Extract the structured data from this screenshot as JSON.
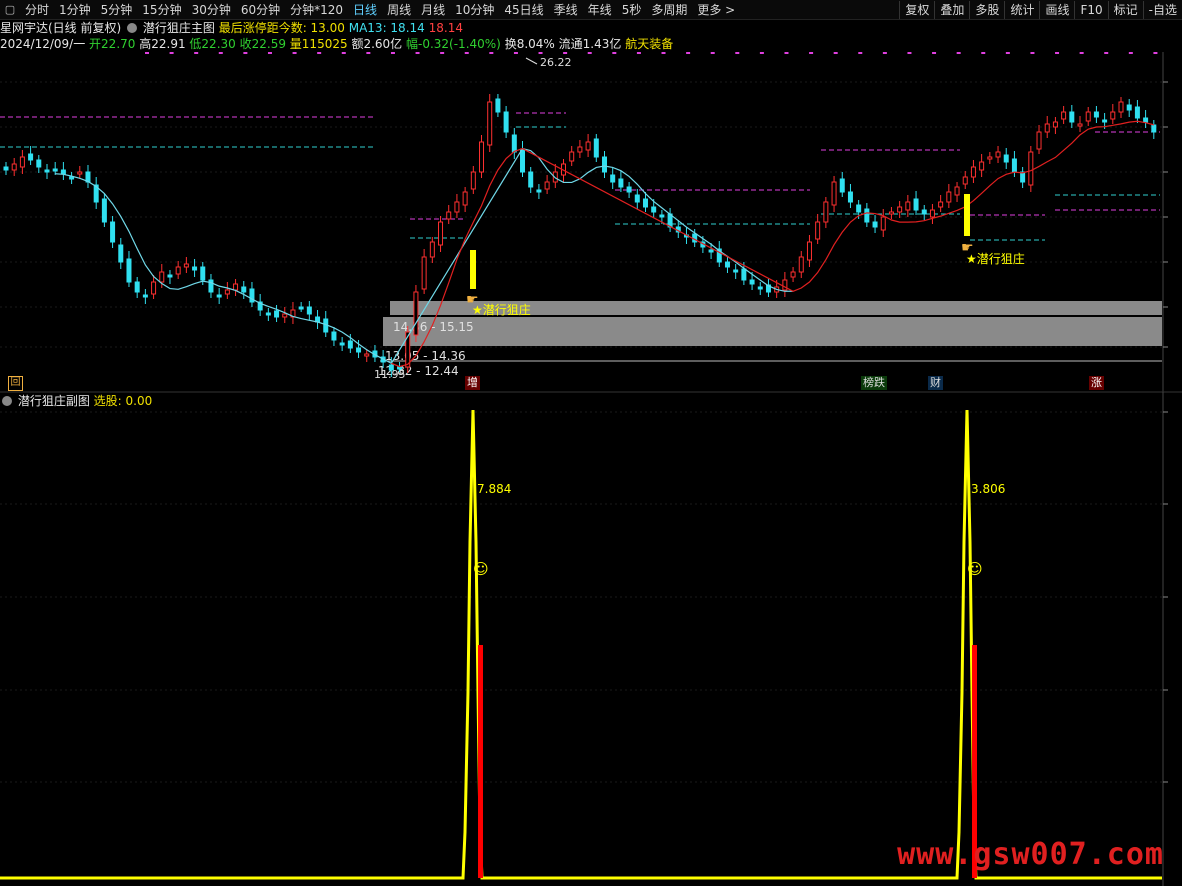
{
  "toolbar": {
    "items": [
      "分时",
      "1分钟",
      "5分钟",
      "15分钟",
      "30分钟",
      "60分钟",
      "分钟*120",
      "日线",
      "周线",
      "月线",
      "10分钟",
      "45日线",
      "季线",
      "年线",
      "5秒",
      "多周期",
      "更多 >"
    ],
    "active": "日线",
    "right_items": [
      "复权",
      "叠加",
      "多股",
      "统计",
      "画线",
      "F10",
      "标记",
      "-自选"
    ]
  },
  "info": {
    "stock_title": "星网宇达(日线 前复权)",
    "indicator_title": "潜行狙庄主图",
    "days_label": "最后涨停距今数: 13.00",
    "ma13": "MA13: 18.14",
    "ma13_val": "18.14",
    "date": "2024/12/09/一",
    "open": "开22.70",
    "high": "高22.91",
    "low": "低22.30",
    "close": "收22.59",
    "vol": "量115025",
    "amount": "额2.60亿",
    "change": "幅-0.32(-1.40%)",
    "turnover": "换8.04%",
    "float": "流通1.43亿",
    "sector": "航天装备"
  },
  "annotations": {
    "peak": "26.22",
    "signal1": "★潜行狙庄",
    "signal2": "★潜行狙庄",
    "box1": "14.36 - 15.15",
    "box2": "13.05 - 14.36",
    "box3": "12.82 - 12.44",
    "low": "11.95",
    "m_hui": "回",
    "m_zeng": "增",
    "m_bangdie": "榜跌",
    "m_cai": "财",
    "m_zhang": "涨",
    "sub_v1": "7.884",
    "sub_v2": "3.806"
  },
  "sub": {
    "title": "潜行狙庄副图",
    "value": "选股: 0.00"
  },
  "watermark": "www.gsw007.com",
  "colors": {
    "up": "#ff3030",
    "down": "#30e0f0",
    "ma": "#70d8e8",
    "ma_red": "#e02020",
    "magenta": "#e040e0",
    "yellow": "#ffff00"
  },
  "chart_data": {
    "type": "candlestick",
    "series": [
      {
        "name": "MA13",
        "values": [
          18.14
        ]
      }
    ],
    "markers": [
      "回",
      "增",
      "榜跌",
      "财",
      "涨"
    ]
  }
}
